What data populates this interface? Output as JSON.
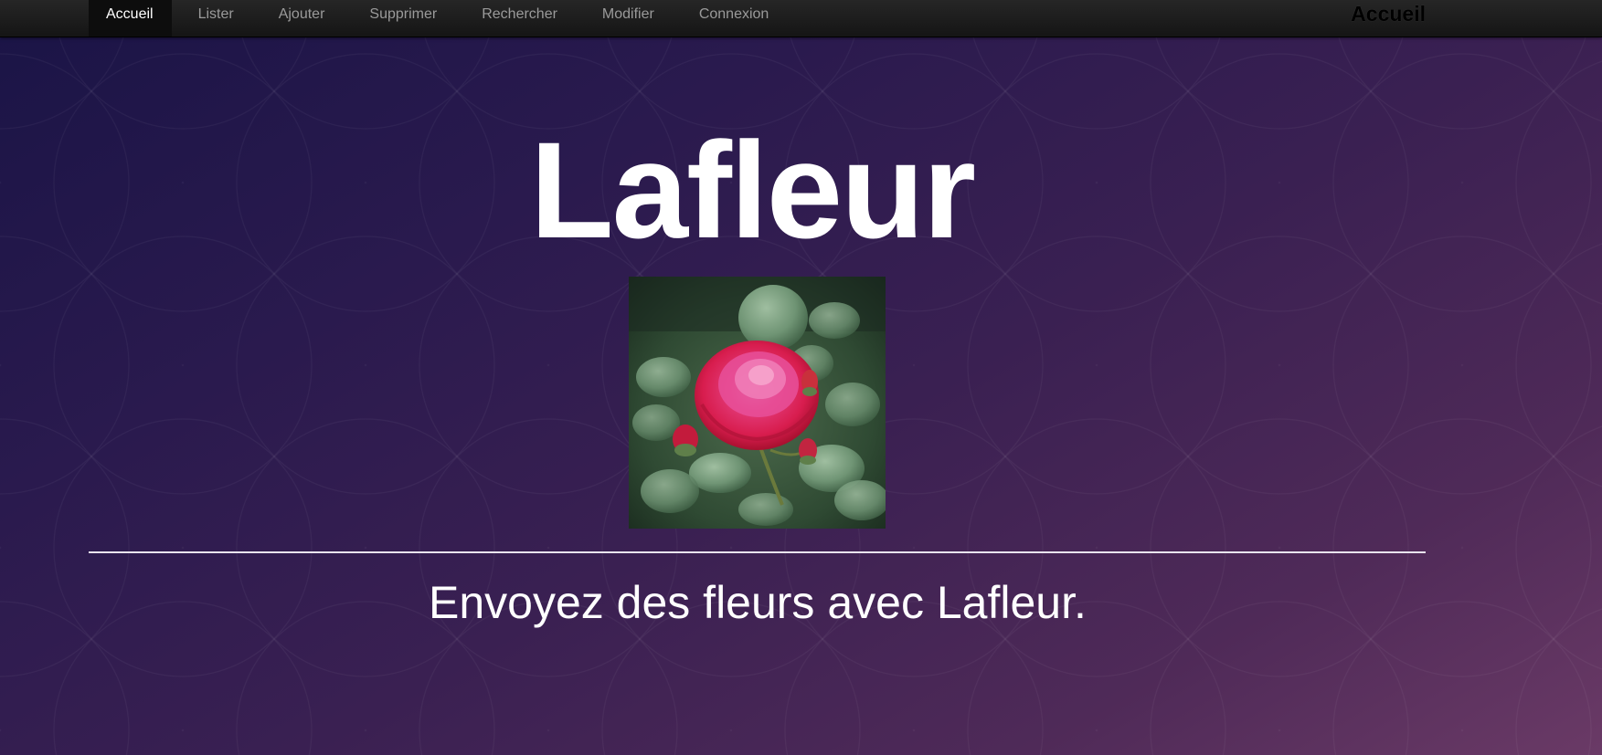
{
  "nav": {
    "items": [
      {
        "label": "Accueil",
        "active": true
      },
      {
        "label": "Lister",
        "active": false
      },
      {
        "label": "Ajouter",
        "active": false
      },
      {
        "label": "Supprimer",
        "active": false
      },
      {
        "label": "Rechercher",
        "active": false
      },
      {
        "label": "Modifier",
        "active": false
      },
      {
        "label": "Connexion",
        "active": false
      }
    ],
    "brand": "Accueil"
  },
  "hero": {
    "title": "Lafleur",
    "image": "red-rose-photo",
    "tagline": "Envoyez des fleurs avec Lafleur."
  },
  "colors": {
    "navbar": "#1b1b1b",
    "active_tab": "#0d0d0d",
    "text": "#ffffff",
    "background_start": "#1a1446",
    "background_end": "#6a3a66"
  }
}
